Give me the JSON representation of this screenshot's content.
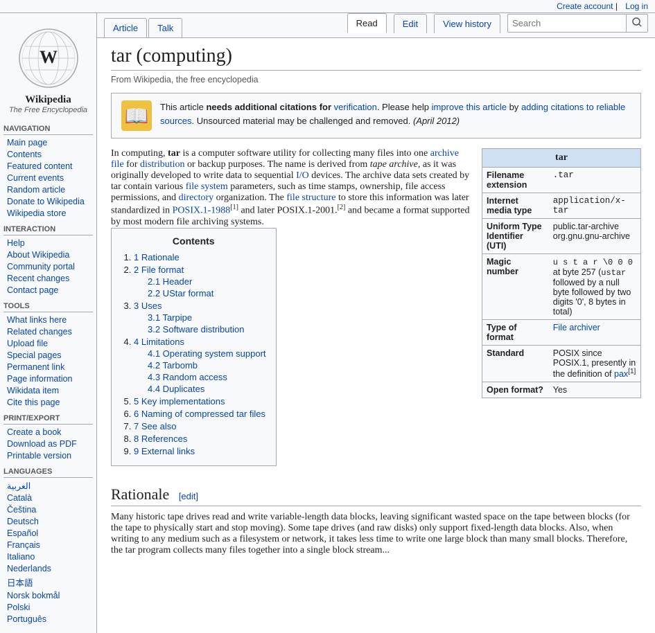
{
  "topbar": {
    "create_account": "Create account",
    "log_in": "Log in"
  },
  "sidebar": {
    "wiki_name": "Wikipedia",
    "wiki_tagline": "The Free Encyclopedia",
    "navigation_heading": "Navigation",
    "nav_items": [
      {
        "label": "Main page",
        "href": "#"
      },
      {
        "label": "Contents",
        "href": "#"
      },
      {
        "label": "Featured content",
        "href": "#"
      },
      {
        "label": "Current events",
        "href": "#"
      },
      {
        "label": "Random article",
        "href": "#"
      },
      {
        "label": "Donate to Wikipedia",
        "href": "#"
      },
      {
        "label": "Wikipedia store",
        "href": "#"
      }
    ],
    "interaction_heading": "Interaction",
    "interaction_items": [
      {
        "label": "Help",
        "href": "#"
      },
      {
        "label": "About Wikipedia",
        "href": "#"
      },
      {
        "label": "Community portal",
        "href": "#"
      },
      {
        "label": "Recent changes",
        "href": "#"
      },
      {
        "label": "Contact page",
        "href": "#"
      }
    ],
    "tools_heading": "Tools",
    "tools_items": [
      {
        "label": "What links here",
        "href": "#"
      },
      {
        "label": "Related changes",
        "href": "#"
      },
      {
        "label": "Upload file",
        "href": "#"
      },
      {
        "label": "Special pages",
        "href": "#"
      },
      {
        "label": "Permanent link",
        "href": "#"
      },
      {
        "label": "Page information",
        "href": "#"
      },
      {
        "label": "Wikidata item",
        "href": "#"
      },
      {
        "label": "Cite this page",
        "href": "#"
      }
    ],
    "print_heading": "Print/export",
    "print_items": [
      {
        "label": "Create a book",
        "href": "#"
      },
      {
        "label": "Download as PDF",
        "href": "#"
      },
      {
        "label": "Printable version",
        "href": "#"
      }
    ],
    "languages_heading": "Languages",
    "language_items": [
      {
        "label": "العربية",
        "href": "#"
      },
      {
        "label": "Català",
        "href": "#"
      },
      {
        "label": "Čeština",
        "href": "#"
      },
      {
        "label": "Deutsch",
        "href": "#"
      },
      {
        "label": "Español",
        "href": "#"
      },
      {
        "label": "Français",
        "href": "#"
      },
      {
        "label": "日本語",
        "href": "#"
      },
      {
        "label": "Italiano",
        "href": "#"
      },
      {
        "label": "Nederlands",
        "href": "#"
      },
      {
        "label": "日本語",
        "href": "#"
      },
      {
        "label": "Norsk bokmål",
        "href": "#"
      },
      {
        "label": "Polski",
        "href": "#"
      },
      {
        "label": "Português",
        "href": "#"
      }
    ]
  },
  "tabs": {
    "article": "Article",
    "talk": "Talk",
    "read": "Read",
    "edit": "Edit",
    "view_history": "View history",
    "search_placeholder": "Search"
  },
  "page": {
    "title": "tar (computing)",
    "subtitle": "From Wikipedia, the free encyclopedia",
    "warning": {
      "text_before": "This article ",
      "bold": "needs additional citations for",
      "linked": "verification",
      "text_after": ". Please help ",
      "link2": "improve this article",
      "text2": " by ",
      "link3": "adding citations to reliable sources",
      "text3": ". Unsourced material may be challenged and removed.",
      "date": "(April 2012)"
    },
    "intro": "In computing, tar is a computer software utility for collecting many files into one archive file for distribution or backup purposes. The name is derived from tape archive, as it was originally developed to write data to sequential I/O devices. The archive data sets created by tar contain various file system parameters, such as time stamps, ownership, file access permissions, and directory organization. The file structure to store this information was later standardized in POSIX.1-1988[1] and later POSIX.1-2001.[2] and became a format supported by most modern file archiving systems.",
    "toc_title": "Contents",
    "toc": [
      {
        "num": "1",
        "label": "Rationale",
        "href": "#rationale",
        "sub": []
      },
      {
        "num": "2",
        "label": "File format",
        "href": "#fileformat",
        "sub": [
          {
            "num": "2.1",
            "label": "Header",
            "href": "#header"
          },
          {
            "num": "2.2",
            "label": "UStar format",
            "href": "#ustar"
          }
        ]
      },
      {
        "num": "3",
        "label": "Uses",
        "href": "#uses",
        "sub": [
          {
            "num": "3.1",
            "label": "Tarpipe",
            "href": "#tarpipe"
          },
          {
            "num": "3.2",
            "label": "Software distribution",
            "href": "#softwaredist"
          }
        ]
      },
      {
        "num": "4",
        "label": "Limitations",
        "href": "#limitations",
        "sub": [
          {
            "num": "4.1",
            "label": "Operating system support",
            "href": "#ossupport"
          },
          {
            "num": "4.2",
            "label": "Tarbomb",
            "href": "#tarbomb"
          },
          {
            "num": "4.3",
            "label": "Random access",
            "href": "#randomaccess"
          },
          {
            "num": "4.4",
            "label": "Duplicates",
            "href": "#duplicates"
          }
        ]
      },
      {
        "num": "5",
        "label": "Key implementations",
        "href": "#implementations",
        "sub": []
      },
      {
        "num": "6",
        "label": "Naming of compressed tar files",
        "href": "#naming",
        "sub": []
      },
      {
        "num": "7",
        "label": "See also",
        "href": "#seealso",
        "sub": []
      },
      {
        "num": "8",
        "label": "References",
        "href": "#references",
        "sub": []
      },
      {
        "num": "9",
        "label": "External links",
        "href": "#externallinks",
        "sub": []
      }
    ],
    "infobox": {
      "title": "tar",
      "rows": [
        {
          "label": "Filename extension",
          "value": ".tar"
        },
        {
          "label": "Internet media type",
          "value": "application/x-tar"
        },
        {
          "label": "Uniform Type Identifier (UTI)",
          "value": "public.tar-archive org.gnu.gnu-archive"
        },
        {
          "label": "Magic number",
          "value": "u s t a r \\0 0 0 at byte 257 (ustar followed by a null byte followed by two digits '0', 8 bytes in total)"
        },
        {
          "label": "Type of format",
          "value": "File archiver"
        },
        {
          "label": "Standard",
          "value": "POSIX since POSIX.1, presently in the definition of pax[1]"
        },
        {
          "label": "Open format?",
          "value": "Yes"
        }
      ]
    },
    "rationale_heading": "Rationale",
    "edit_label": "[edit]",
    "rationale_text": "Many historic tape drives read and write variable-length data blocks, leaving significant wasted space on the tape between blocks (for the tape to physically start and stop moving). Some tape drives (and raw disks) only support fixed-length data blocks. Also, when writing to any medium such as a filesystem or network, it takes less time to write one large block than many small blocks. Therefore, the tar program collects many files together into a single block stream..."
  }
}
